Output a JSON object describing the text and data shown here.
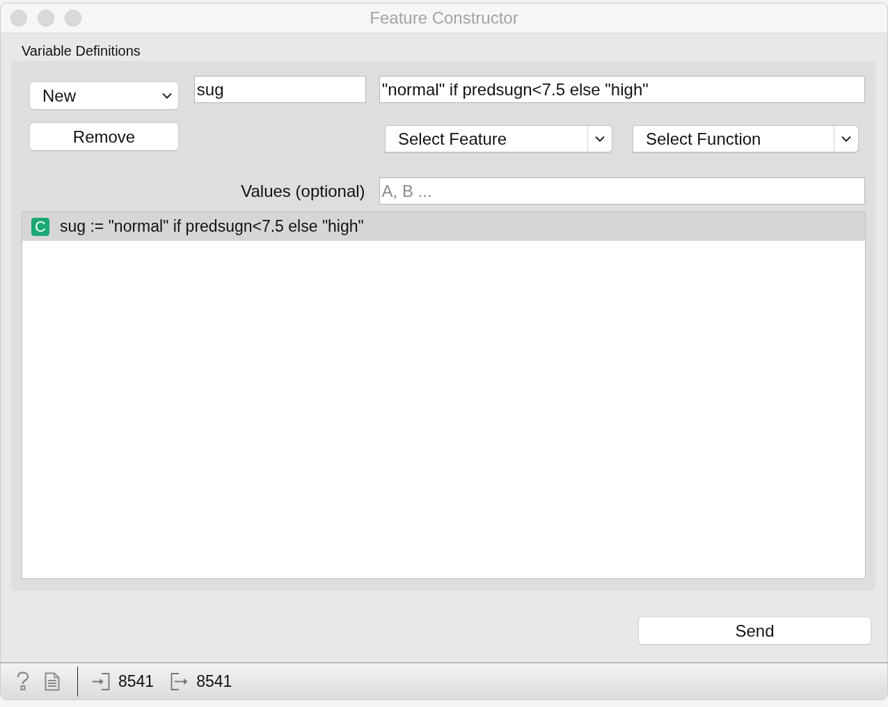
{
  "window": {
    "title": "Feature Constructor"
  },
  "group": {
    "title": "Variable Definitions"
  },
  "new_combo": {
    "value": "New"
  },
  "name_field": {
    "value": "sug"
  },
  "expression_field": {
    "value": "\"normal\" if predsugn<7.5 else \"high\""
  },
  "remove_button": {
    "label": "Remove"
  },
  "feature_combo": {
    "value": "Select Feature"
  },
  "function_combo": {
    "value": "Select Function"
  },
  "values_field": {
    "label": "Values (optional)",
    "placeholder": "A, B ..."
  },
  "definitions": [
    {
      "badge": "C",
      "color": "#1aa873",
      "text": "sug := \"normal\" if predsugn<7.5 else \"high\"",
      "selected": true
    }
  ],
  "send_button": {
    "label": "Send"
  },
  "status_bar": {
    "input_count": "8541",
    "output_count": "8541"
  }
}
